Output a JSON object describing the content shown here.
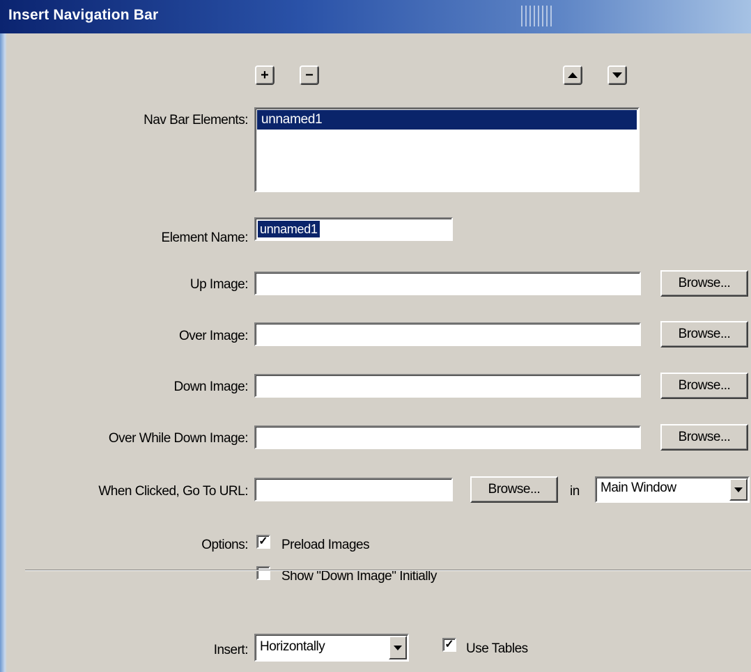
{
  "window": {
    "title": "Insert Navigation Bar"
  },
  "toolbar": {
    "add_symbol": "+",
    "remove_symbol": "−",
    "move_up_icon": "triangle-up",
    "move_down_icon": "triangle-down"
  },
  "nav_bar_elements": {
    "label": "Nav Bar Elements:",
    "items": [
      "unnamed1"
    ]
  },
  "element_name": {
    "label": "Element Name:",
    "value": "unnamed1"
  },
  "up_image": {
    "label": "Up Image:",
    "value": "",
    "browse": "Browse..."
  },
  "over_image": {
    "label": "Over Image:",
    "value": "",
    "browse": "Browse..."
  },
  "down_image": {
    "label": "Down Image:",
    "value": "",
    "browse": "Browse..."
  },
  "over_while_down_image": {
    "label": "Over While Down Image:",
    "value": "",
    "browse": "Browse..."
  },
  "go_to_url": {
    "label": "When Clicked, Go To URL:",
    "value": "",
    "browse": "Browse...",
    "in_label": "in",
    "target": "Main Window"
  },
  "options": {
    "label": "Options:",
    "preload_images": {
      "label": "Preload Images",
      "checked": true
    },
    "show_down_initially": {
      "label": "Show \"Down Image\" Initially",
      "checked": false
    }
  },
  "insert": {
    "label": "Insert:",
    "orientation": "Horizontally",
    "use_tables": {
      "label": "Use Tables",
      "checked": true
    }
  },
  "colors": {
    "dialog_bg": "#d4d0c8",
    "selection": "#0a246a",
    "title_start": "#0b2470",
    "title_end": "#a6c2e4"
  }
}
